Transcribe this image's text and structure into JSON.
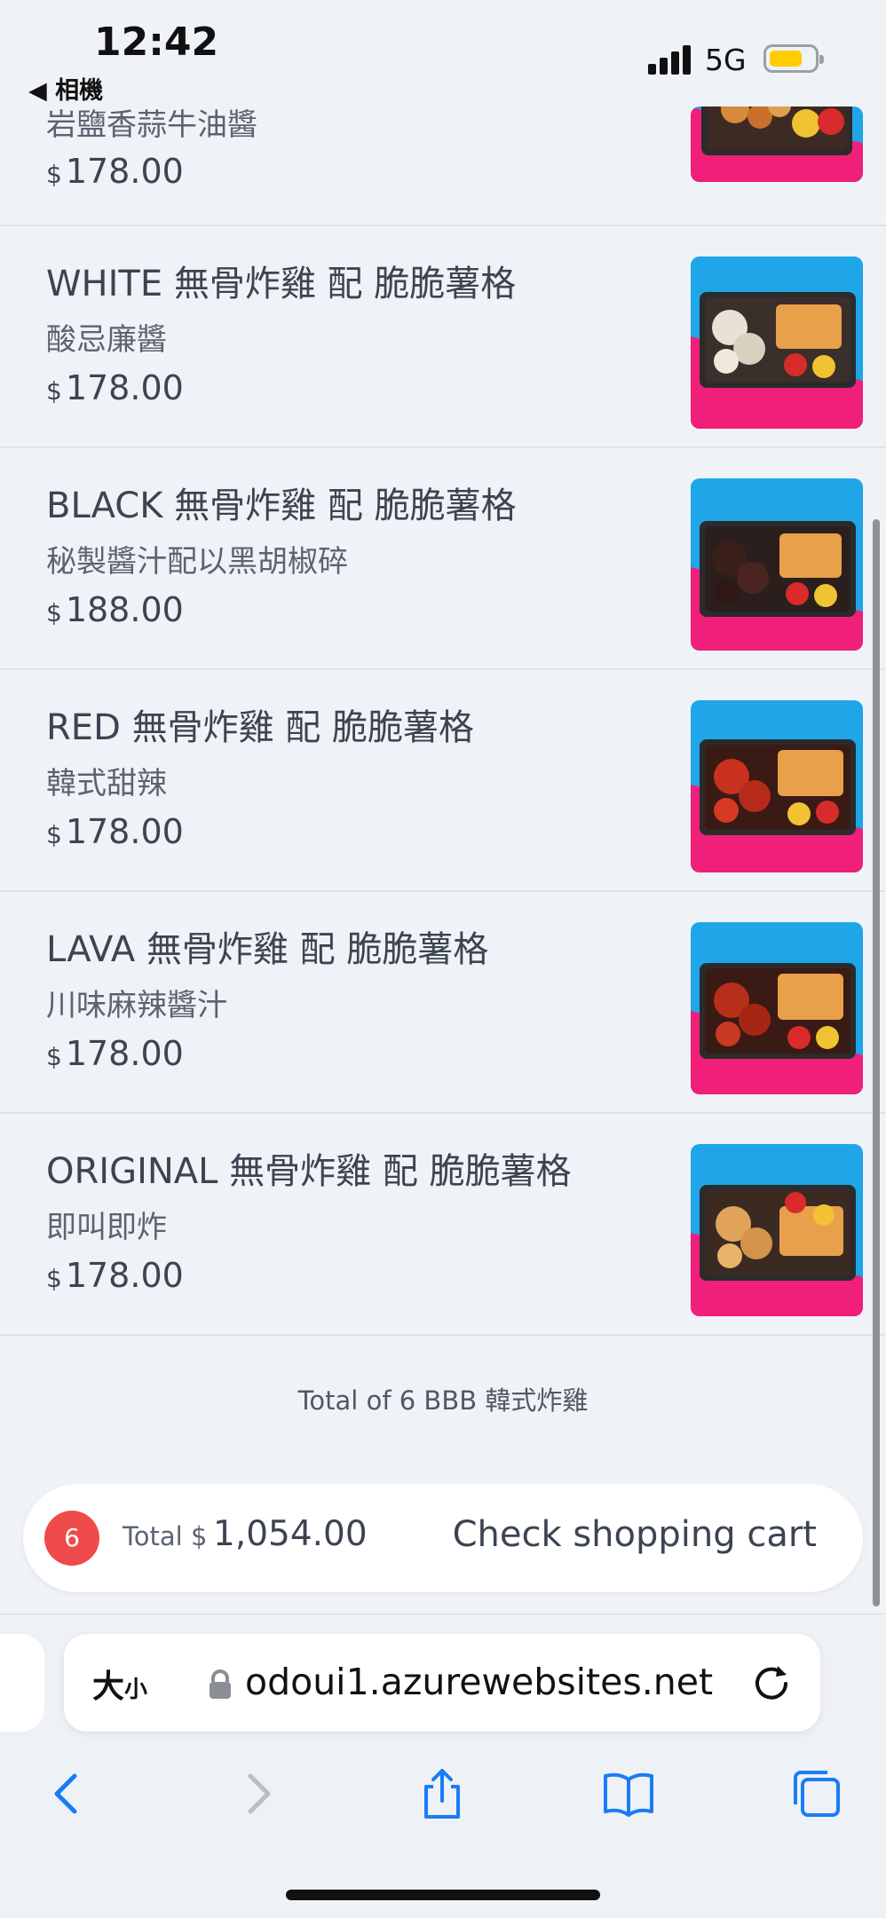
{
  "status_bar": {
    "time": "12:42",
    "back_app": "◀ 相機",
    "network": "5G"
  },
  "items": [
    {
      "name": "",
      "desc": "岩鹽香蒜牛油醬",
      "currency": "$",
      "price": "178.00"
    },
    {
      "name": "WHITE 無骨炸雞 配 脆脆薯格",
      "desc": "酸忌廉醬",
      "currency": "$",
      "price": "178.00"
    },
    {
      "name": "BLACK 無骨炸雞 配 脆脆薯格",
      "desc": "秘製醬汁配以黑胡椒碎",
      "currency": "$",
      "price": "188.00"
    },
    {
      "name": "RED 無骨炸雞 配 脆脆薯格",
      "desc": "韓式甜辣",
      "currency": "$",
      "price": "178.00"
    },
    {
      "name": "LAVA 無骨炸雞 配 脆脆薯格",
      "desc": "川味麻辣醬汁",
      "currency": "$",
      "price": "178.00"
    },
    {
      "name": "ORIGINAL 無骨炸雞 配 脆脆薯格",
      "desc": "即叫即炸",
      "currency": "$",
      "price": "178.00"
    }
  ],
  "total_count_text": "Total of 6 BBB 韓式炸雞",
  "cart": {
    "count": "6",
    "total_label": "Total $",
    "total_amount": "1,054.00",
    "checkout_label": "Check shopping cart"
  },
  "browser": {
    "text_size_label": "大",
    "text_size_small": "小",
    "url": "odoui1.azurewebsites.net"
  },
  "colors": {
    "accent_badge": "#ef4b4b",
    "page_bg": "#eff2f6",
    "safari_blue": "#1a7cf5",
    "thumb_blue": "#1fa6e8",
    "thumb_pink": "#ef1f7a"
  }
}
